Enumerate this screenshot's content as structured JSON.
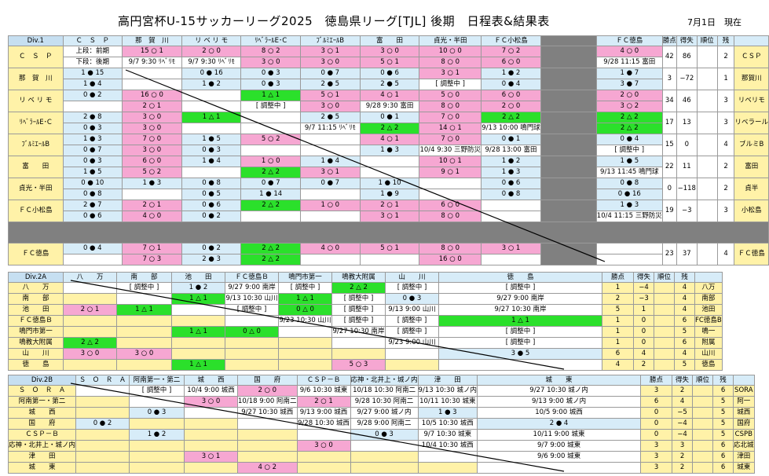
{
  "title": "高円宮杯U-15サッカーリーグ2025　徳島県リーグ[TJL] 後期　日程表&結果表",
  "date": "7月1日　現在",
  "div1": {
    "name": "Div.1",
    "cols": [
      "Ｃ　Ｓ　Ｐ",
      "那　賀　川",
      "リ ベ リ モ",
      "ﾘﾍﾞﾗｰﾙE･C",
      "ﾌﾞﾙﾐｴｰﾙB",
      "富　　田",
      "貞光・半田",
      "ＦＣ小松島",
      "",
      "ＦＣ徳島",
      "勝点",
      "得失",
      "順位",
      "残"
    ],
    "rows": [
      {
        "team": "Ｃ　Ｓ　Ｐ",
        "side": "ＣＳＰ",
        "cells": [
          [
            "上段：前期",
            "下段：後期"
          ],
          [
            "15 ○ 1",
            "9/7 9:30 ﾘﾍﾞﾘﾓ"
          ],
          [
            "2 ○ 0",
            "9/7 9:30 ﾘﾍﾞﾘﾓ"
          ],
          [
            "8 ○ 2",
            "3 ○ 0"
          ],
          [
            "3 ○ 1",
            "3 ○ 0"
          ],
          [
            "3 ○ 0",
            "5 ○ 1"
          ],
          [
            "10 ○ 0",
            "8 ○ 0"
          ],
          [
            "7 ○ 2",
            "6 ○ 0"
          ],
          [
            "",
            ""
          ],
          [
            "4 ○ 0",
            "9/28 11:15 富田"
          ]
        ],
        "pts": "42",
        "gd": "86",
        "rank": "",
        "rem": "2"
      },
      {
        "team": "那　賀　川",
        "side": "那賀川",
        "cells": [
          [
            "1 ● 15",
            "1 ● 4"
          ],
          [
            "",
            ""
          ],
          [
            "0 ● 16",
            "1 ● 2"
          ],
          [
            "0 ● 3",
            "0 ● 3"
          ],
          [
            "0 ● 7",
            "2 ● 5"
          ],
          [
            "0 ● 6",
            "2 ● 5"
          ],
          [
            "3 ○ 1",
            "[ 調整中 ]"
          ],
          [
            "1 ● 2",
            "0 ● 4"
          ],
          [
            "",
            ""
          ],
          [
            "1 ● 7",
            "3 ● 7"
          ]
        ],
        "pts": "3",
        "gd": "−72",
        "rank": "",
        "rem": "1"
      },
      {
        "team": "リ ベ リ モ",
        "side": "リベリモ",
        "cells": [
          [
            "0 ● 2",
            ""
          ],
          [
            "16 ○ 0",
            "2 ○ 1"
          ],
          [
            "",
            ""
          ],
          [
            "1 △ 1",
            "[ 調整中 ]"
          ],
          [
            "5 ○ 1",
            "3 ○ 0"
          ],
          [
            "4 ○ 1",
            "9/28 9:30 富田"
          ],
          [
            "5 ○ 0",
            "8 ○ 0"
          ],
          [
            "6 ○ 0",
            "2 ○ 0"
          ],
          [
            "",
            ""
          ],
          [
            "2 ○ 0",
            "3 ○ 2"
          ]
        ],
        "pts": "34",
        "gd": "46",
        "rank": "",
        "rem": "3"
      },
      {
        "team": "ﾘﾍﾞﾗｰﾙE･C",
        "side": "リベラール",
        "cells": [
          [
            "2 ● 8",
            "0 ● 3"
          ],
          [
            "3 ○ 0",
            "3 ○ 0"
          ],
          [
            "1 △ 1",
            ""
          ],
          [
            "",
            ""
          ],
          [
            "2 ● 5",
            "9/7 11:15 ﾘﾍﾞﾘﾓ"
          ],
          [
            "0 ● 1",
            "2 △ 2"
          ],
          [
            "7 ○ 0",
            "14 ○ 1"
          ],
          [
            "2 △ 2",
            "9/13 10:00 鳴門球"
          ],
          [
            "",
            ""
          ],
          [
            "2 △ 2",
            "2 △ 2"
          ]
        ],
        "pts": "17",
        "gd": "13",
        "rank": "",
        "rem": "3"
      },
      {
        "team": "ﾌﾞﾙﾐｴｰﾙB",
        "side": "ブルミB",
        "cells": [
          [
            "1 ● 3",
            "0 ● 7"
          ],
          [
            "7 ○ 0",
            "3 ○ 0"
          ],
          [
            "1 ● 5",
            "0 ● 3"
          ],
          [
            "5 ○ 2",
            ""
          ],
          [
            "",
            ""
          ],
          [
            "4 ○ 1",
            "1 ● 3"
          ],
          [
            "7 ○ 0",
            "10/4 9:30 三野防災"
          ],
          [
            "0 ● 1",
            "9/28 13:00 富田"
          ],
          [
            "",
            ""
          ],
          [
            "0 ● 4",
            "[ 調整中 ]"
          ]
        ],
        "pts": "15",
        "gd": "0",
        "rank": "",
        "rem": "4"
      },
      {
        "team": "富　　田",
        "side": "富田",
        "cells": [
          [
            "0 ● 3",
            "1 ● 5"
          ],
          [
            "6 ○ 0",
            "5 ○ 2"
          ],
          [
            "1 ● 4",
            ""
          ],
          [
            "1 ○ 0",
            "2 △ 2"
          ],
          [
            "1 ● 4",
            "3 ○ 1"
          ],
          [
            "",
            ""
          ],
          [
            "10 ○ 1",
            "9 ○ 1"
          ],
          [
            "1 ● 2",
            "1 ● 3"
          ],
          [
            "",
            ""
          ],
          [
            "1 ● 5",
            "9/13 11:45 鳴門球"
          ]
        ],
        "pts": "22",
        "gd": "11",
        "rank": "",
        "rem": "2"
      },
      {
        "team": "貞光・半田",
        "side": "貞半",
        "cells": [
          [
            "0 ● 10",
            "0 ● 8"
          ],
          [
            "1 ● 3",
            ""
          ],
          [
            "0 ● 8",
            "0 ● 5"
          ],
          [
            "0 ● 7",
            "1 ● 14"
          ],
          [
            "0 ● 7",
            ""
          ],
          [
            "1 ● 10",
            "1 ● 9"
          ],
          [
            "",
            ""
          ],
          [
            "0 ● 6",
            "0 ● 8"
          ],
          [
            "",
            ""
          ],
          [
            "0 ● 8",
            "0 ● 16"
          ]
        ],
        "pts": "0",
        "gd": "−118",
        "rank": "",
        "rem": "2"
      },
      {
        "team": "ＦＣ小松島",
        "side": "小松島",
        "cells": [
          [
            "2 ● 7",
            "0 ● 6"
          ],
          [
            "2 ○ 1",
            "4 ○ 0"
          ],
          [
            "0 ● 6",
            "0 ● 2"
          ],
          [
            "2 △ 2",
            ""
          ],
          [
            "1 ○ 0",
            ""
          ],
          [
            "2 ○ 1",
            "3 ○ 1"
          ],
          [
            "6 ○ 0",
            "8 ○ 0"
          ],
          [
            "",
            ""
          ],
          [
            "",
            ""
          ],
          [
            "1 ● 3",
            "10/4 11:15 三野防災"
          ]
        ],
        "pts": "19",
        "gd": "−3",
        "rank": "",
        "rem": "3"
      },
      {
        "team": "ＦＣ徳島",
        "side": "ＦＣ徳島",
        "cells": [
          [
            "0 ● 4",
            ""
          ],
          [
            "7 ○ 1",
            "7 ○ 3"
          ],
          [
            "0 ● 2",
            "2 ● 3"
          ],
          [
            "2 △ 2",
            "2 △ 2"
          ],
          [
            "4 ○ 0",
            ""
          ],
          [
            "5 ○ 1",
            ""
          ],
          [
            "8 ○ 0",
            "16 ○ 0"
          ],
          [
            "3 ○ 1",
            ""
          ],
          [
            "",
            ""
          ],
          [
            "",
            ""
          ]
        ],
        "pts": "23",
        "gd": "37",
        "rank": "",
        "rem": "4"
      }
    ]
  },
  "div2a": {
    "name": "Div.2A",
    "cols": [
      "八　　万",
      "南　　部",
      "池　　田",
      "ＦＣ徳島Ｂ",
      "鳴門市第一",
      "鳴教大附属",
      "山　　川",
      "徳　　島",
      "勝点",
      "得失",
      "順位",
      "残"
    ],
    "rows": [
      {
        "team": "八　　万",
        "cells": [
          "",
          "[ 調整中 ]",
          "1 ● 2",
          "9/27 9:00 南岸",
          "[ 調整中 ]",
          "2 △ 2",
          "[ 調整中 ]",
          "[ 調整中 ]"
        ],
        "pts": "1",
        "gd": "−4",
        "rem": "4",
        "side": "八万"
      },
      {
        "team": "南　　部",
        "cells": [
          "",
          "",
          "1 △ 1",
          "9/13 10:30 山川",
          "1 △ 1",
          "[ 調整中 ]",
          "0 ● 3",
          "9/27 9:00 南岸"
        ],
        "pts": "2",
        "gd": "−3",
        "rem": "4",
        "side": "南部"
      },
      {
        "team": "池　　田",
        "cells": [
          "2 ○ 1",
          "1 △ 1",
          "",
          "[ 調整中 ]",
          "0 △ 0",
          "[ 調整中 ]",
          "9/13 9:00 山川",
          "9/27 10:30 南岸"
        ],
        "pts": "5",
        "gd": "1",
        "rem": "4",
        "side": "池田"
      },
      {
        "team": "ＦＣ徳島Ｂ",
        "cells": [
          "",
          "",
          "",
          "",
          "9/23 10:30 山川",
          "[ 調整中 ]",
          "[ 調整中 ]",
          "1 △ 1"
        ],
        "pts": "1",
        "gd": "0",
        "rem": "6",
        "side": "FC徳島B"
      },
      {
        "team": "鳴門市第一",
        "cells": [
          "",
          "",
          "1 △ 1",
          "0 △ 0",
          "",
          "9/27 10:30 南岸",
          "[ 調整中 ]",
          "[ 調整中 ]"
        ],
        "pts": "1",
        "gd": "0",
        "rem": "5",
        "side": "鳴一"
      },
      {
        "team": "鳴教大附属",
        "cells": [
          "2 △ 2",
          "",
          "",
          "",
          "",
          "",
          "9/23 9:00 山川",
          "[ 調整中 ]"
        ],
        "pts": "1",
        "gd": "0",
        "rem": "6",
        "side": "附属"
      },
      {
        "team": "山　　川",
        "cells": [
          "3 ○ 0",
          "3 ○ 0",
          "",
          "",
          "",
          "",
          "",
          "3 ● 5"
        ],
        "pts": "6",
        "gd": "4",
        "rem": "4",
        "side": "山川"
      },
      {
        "team": "徳　　島",
        "cells": [
          "",
          "",
          "1 △ 1",
          "",
          "",
          "5 ○ 3",
          "",
          ""
        ],
        "pts": "4",
        "gd": "2",
        "rem": "5",
        "side": "徳島"
      }
    ]
  },
  "div2b": {
    "name": "Div.2B",
    "cols": [
      "Ｓ　Ｏ　Ｒ　Ａ",
      "阿南第一・第二",
      "城　　西",
      "国　　府",
      "ＣＳＰ－Ｂ",
      "応神・北井上・城ノ内",
      "津　　田",
      "城　　東",
      "勝点",
      "得失",
      "順位",
      "残"
    ],
    "rows": [
      {
        "team": "Ｓ　Ｏ　Ｒ　Ａ",
        "cells": [
          "",
          "[ 調整中 ]",
          "10/4 9:00 城西",
          "2 ○ 0",
          "9/6 10:30 城東",
          "10/18 10:30 阿南二",
          "9/13 10:30 城ノ内",
          "9/27 10:30 城ノ内"
        ],
        "pts": "3",
        "gd": "2",
        "rem": "6",
        "side": "SORA"
      },
      {
        "team": "阿南第一・第二",
        "cells": [
          "",
          "",
          "3 ○ 0",
          "10/18 9:00 阿南二",
          "2 ○ 1",
          "9/28 10:30 阿南二",
          "10/11 10:30 城東",
          "9/13 9:00 城ノ内"
        ],
        "pts": "6",
        "gd": "4",
        "rem": "5",
        "side": "阿一"
      },
      {
        "team": "城　　西",
        "cells": [
          "",
          "0 ● 3",
          "",
          "9/27 10:30 城西",
          "9/13 9:00 城西",
          "9/27 9:00 城ノ内",
          "1 ● 3",
          "10/5 9:00 城西"
        ],
        "pts": "0",
        "gd": "−5",
        "rem": "5",
        "side": "城西"
      },
      {
        "team": "国　　府",
        "cells": [
          "0 ● 2",
          "",
          "",
          "",
          "9/28 10:30 城西",
          "9/28 9:00 阿南二",
          "10/5 10:30 城西",
          "2 ● 4"
        ],
        "pts": "0",
        "gd": "−4",
        "rem": "5",
        "side": "国府"
      },
      {
        "team": "ＣＳＰ－Ｂ",
        "cells": [
          "",
          "1 ● 2",
          "",
          "",
          "",
          "0 ● 3",
          "9/7 10:30 城東",
          "10/11 9:00 城東"
        ],
        "pts": "0",
        "gd": "−4",
        "rem": "5",
        "side": "CSPB"
      },
      {
        "team": "応神・北井上・城ノ内",
        "cells": [
          "",
          "",
          "",
          "",
          "3 ○ 0",
          "",
          "10/4 10:30 城西",
          "9/7 9:00 城東"
        ],
        "pts": "3",
        "gd": "3",
        "rem": "6",
        "side": "応北城"
      },
      {
        "team": "津　　田",
        "cells": [
          "",
          "",
          "3 ○ 1",
          "",
          "",
          "",
          "",
          "9/6 9:00 城東"
        ],
        "pts": "3",
        "gd": "2",
        "rem": "6",
        "side": "津田"
      },
      {
        "team": "城　　東",
        "cells": [
          "",
          "",
          "",
          "4 ○ 2",
          "",
          "",
          "",
          ""
        ],
        "pts": "3",
        "gd": "2",
        "rem": "6",
        "side": "城東"
      }
    ]
  }
}
